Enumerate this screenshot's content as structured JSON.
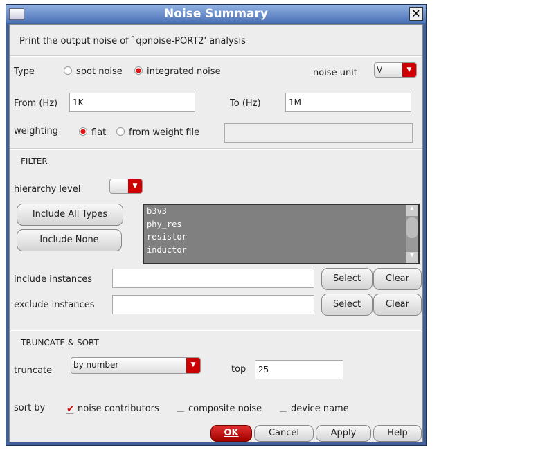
{
  "title": "Noise Summary",
  "description": "Print the output noise of `qpnoise-PORT2' analysis",
  "type": {
    "label": "Type",
    "options": [
      {
        "label": "spot noise",
        "selected": false
      },
      {
        "label": "integrated noise",
        "selected": true
      }
    ]
  },
  "noise_unit": {
    "label": "noise unit",
    "value": "V"
  },
  "from": {
    "label": "From (Hz)",
    "value": "1K"
  },
  "to": {
    "label": "To (Hz)",
    "value": "1M"
  },
  "weighting": {
    "label": "weighting",
    "options": [
      {
        "label": "flat",
        "selected": true
      },
      {
        "label": "from weight file",
        "selected": false
      }
    ],
    "file": ""
  },
  "filter": {
    "heading": "FILTER",
    "hierarchy_label": "hierarchy level",
    "hierarchy_value": "",
    "include_all": "Include All Types",
    "include_none": "Include None",
    "types": [
      "b3v3",
      "phy_res",
      "resistor",
      "inductor"
    ],
    "include_instances": {
      "label": "include instances",
      "value": "",
      "select": "Select",
      "clear": "Clear"
    },
    "exclude_instances": {
      "label": "exclude instances",
      "value": "",
      "select": "Select",
      "clear": "Clear"
    }
  },
  "truncate": {
    "heading": "TRUNCATE & SORT",
    "label": "truncate",
    "value": "by number",
    "top_label": "top",
    "top_value": "25"
  },
  "sort": {
    "label": "sort by",
    "options": [
      {
        "label": "noise contributors",
        "checked": true
      },
      {
        "label": "composite noise",
        "checked": false
      },
      {
        "label": "device name",
        "checked": false
      }
    ]
  },
  "buttons": {
    "ok": "OK",
    "cancel": "Cancel",
    "apply": "Apply",
    "help": "Help"
  },
  "colors": {
    "accent": "#cc0000",
    "title_bar": "#4c72b8"
  }
}
